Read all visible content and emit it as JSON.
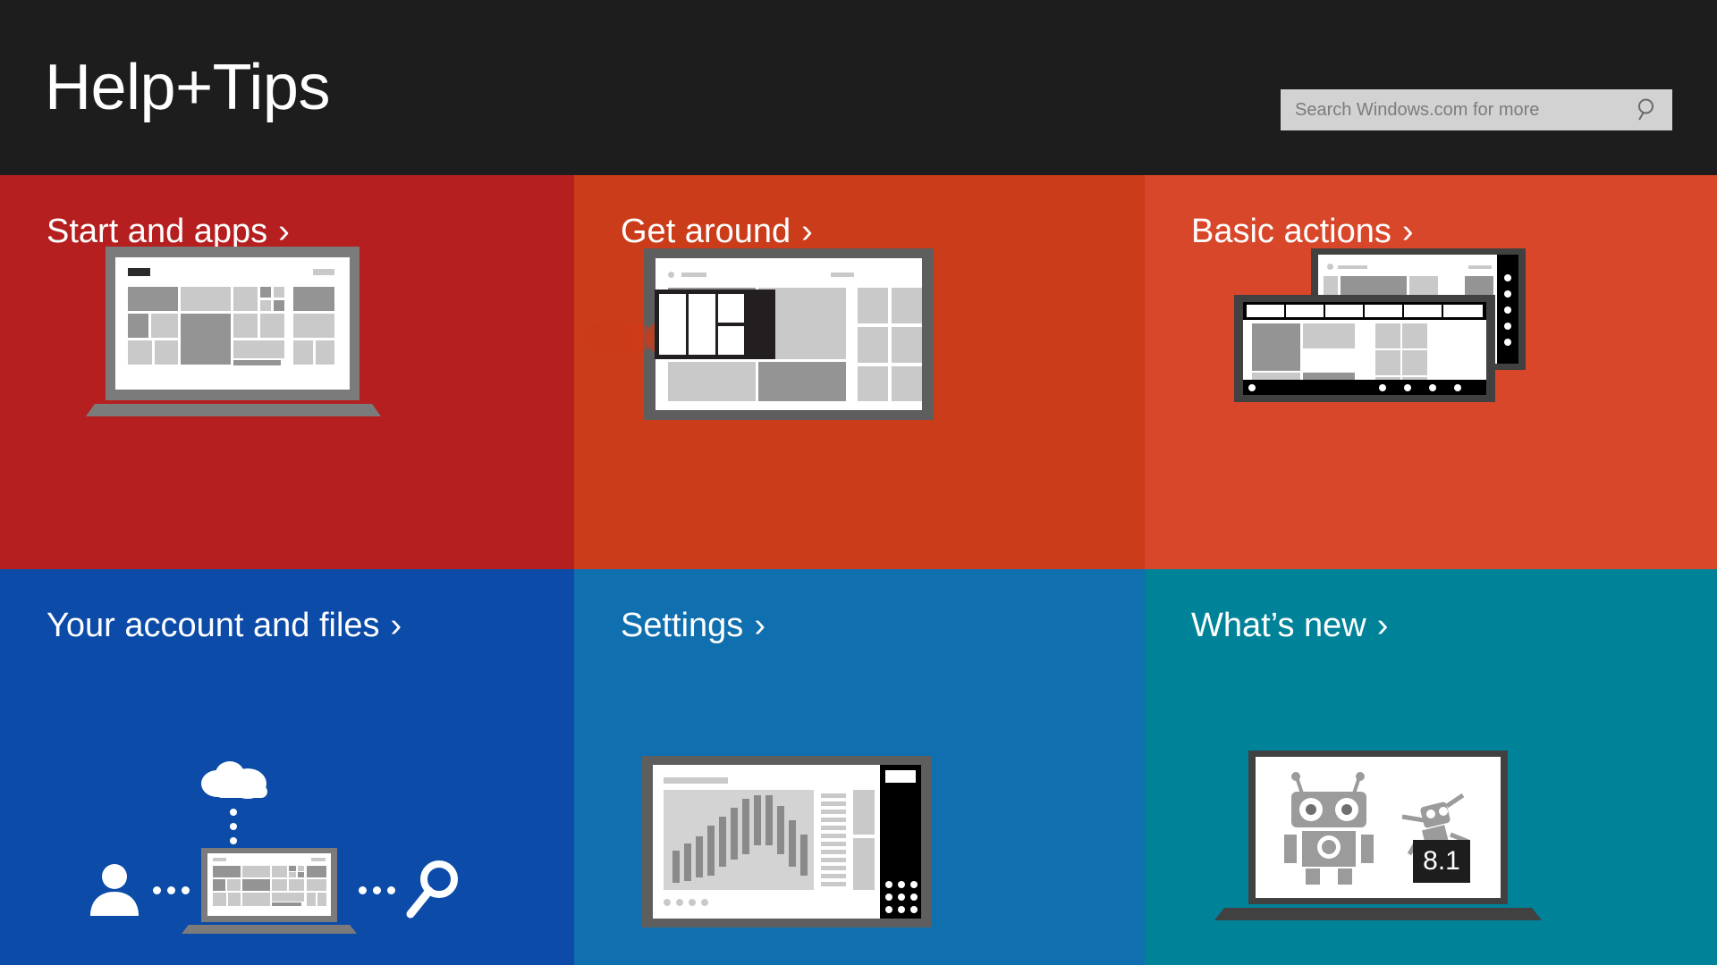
{
  "header": {
    "title": "Help+Tips",
    "background_color": "#1d1d1d",
    "search": {
      "placeholder": "Search Windows.com for more",
      "value": "",
      "icon": "search-icon",
      "background_color": "#d2d2d2"
    }
  },
  "tiles": [
    {
      "id": "start-and-apps",
      "label": "Start and apps",
      "chevron": "›",
      "color": "#b51f20",
      "illustration": "laptop-start-screen"
    },
    {
      "id": "get-around",
      "label": "Get around",
      "chevron": "›",
      "color": "#cb3c1a",
      "illustration": "monitor-swipe-gesture"
    },
    {
      "id": "basic-actions",
      "label": "Basic actions",
      "chevron": "›",
      "color": "#d9472a",
      "illustration": "two-tablets-charms"
    },
    {
      "id": "your-account-and-files",
      "label": "Your account and files",
      "chevron": "›",
      "color": "#0c4ba8",
      "illustration": "cloud-person-laptop-search"
    },
    {
      "id": "settings",
      "label": "Settings",
      "chevron": "›",
      "color": "#106fae",
      "illustration": "tablet-chart-settings"
    },
    {
      "id": "whats-new",
      "label": "What’s new",
      "chevron": "›",
      "color": "#008299",
      "illustration": "laptop-robots",
      "badge": "8.1"
    }
  ]
}
